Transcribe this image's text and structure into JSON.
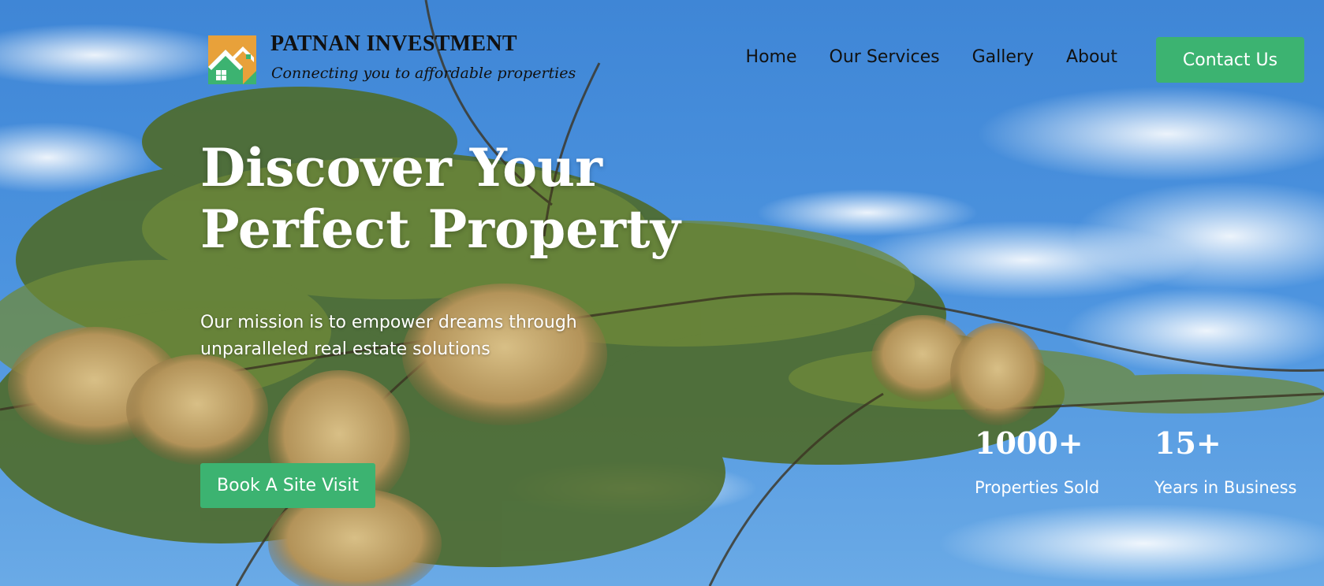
{
  "brand": {
    "name": "PATNAN INVESTMENT",
    "tagline": "Connecting you to affordable properties",
    "logo_icon": "house-logo-icon"
  },
  "nav": {
    "items": [
      {
        "label": "Home"
      },
      {
        "label": "Our Services"
      },
      {
        "label": "Gallery"
      },
      {
        "label": "About"
      }
    ],
    "cta_label": "Contact Us"
  },
  "hero": {
    "title_line1": "Discover Your",
    "title_line2": "Perfect Property",
    "mission": "Our mission is to empower dreams through unparalleled real estate solutions",
    "cta_label": "Book A Site Visit"
  },
  "stats": [
    {
      "value": "1000+",
      "label": "Properties Sold"
    },
    {
      "value": "15+",
      "label": "Years in Business"
    }
  ],
  "colors": {
    "accent_green": "#3cb371",
    "sky_blue": "#4a90d9",
    "logo_orange": "#e8a13a",
    "logo_green": "#3cb371"
  }
}
